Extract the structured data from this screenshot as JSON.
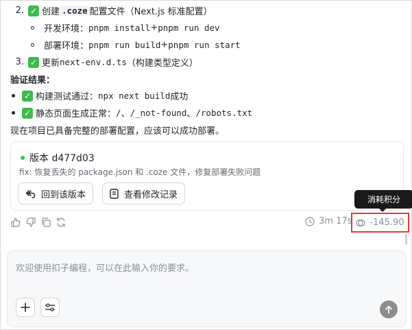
{
  "steps": {
    "step2": {
      "num": "2.",
      "prefix": "创建 ",
      "code": ".coze",
      "suffix": " 配置文件（Next.js 标准配置）"
    },
    "dev_env": {
      "label": "开发环境：",
      "cmd1": "pnpm install",
      "plus": " + ",
      "cmd2": "pnpm run dev"
    },
    "deploy_env": {
      "label": "部署环境：",
      "cmd1": "pnpm run build",
      "plus": " + ",
      "cmd2": "pnpm run start"
    },
    "step3": {
      "num": "3.",
      "prefix": "更新 ",
      "code": "next-env.d.ts",
      "suffix": "（构建类型定义）"
    }
  },
  "verify": {
    "title": "验证结果：",
    "item1": {
      "text": "构建测试通过：",
      "code": "npx next build",
      "suffix": " 成功"
    },
    "item2": {
      "text": "静态页面生成正常：",
      "code1": "/",
      "sep1": "、",
      "code2": "/_not-found",
      "sep2": "、",
      "code3": "/robots.txt"
    }
  },
  "summary": "现在项目已具备完整的部署配置，应该可以成功部署。",
  "version_card": {
    "title": "版本 d477d03",
    "description": "fix: 恢复丢失的 package.json 和 .coze 文件，修复部署失败问题",
    "revert_button": "回到该版本",
    "history_button": "查看修改记录",
    "status_color": "#34c759"
  },
  "toolbar": {
    "duration": "3m 17s",
    "cost": "-145.90",
    "tooltip": "消耗积分",
    "icons": [
      "thumbs-up-icon",
      "thumbs-down-icon",
      "copy-icon",
      "retry-icon",
      "clock-icon",
      "coin-icon"
    ]
  },
  "input": {
    "placeholder": "欢迎使用扣子编程，可以在此输入你的要求。"
  },
  "colors": {
    "check_green": "#3fb950",
    "highlight_red": "#e53935",
    "send_gray": "#8d8d8d"
  }
}
